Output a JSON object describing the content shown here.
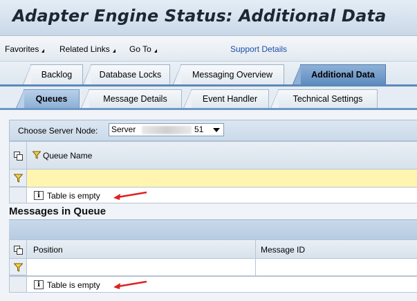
{
  "window": {
    "title": "Adapter Engine Status: Additional Data"
  },
  "menu": {
    "items": [
      {
        "label": "Favorites"
      },
      {
        "label": "Related Links"
      },
      {
        "label": "Go To"
      }
    ],
    "link": "Support Details"
  },
  "main_tabs": [
    {
      "label": "Backlog",
      "active": false
    },
    {
      "label": "Database Locks",
      "active": false
    },
    {
      "label": "Messaging Overview",
      "active": false
    },
    {
      "label": "Additional Data",
      "active": true
    }
  ],
  "sub_tabs": [
    {
      "label": "Queues",
      "active": true
    },
    {
      "label": "Message Details",
      "active": false
    },
    {
      "label": "Event Handler",
      "active": false
    },
    {
      "label": "Technical Settings",
      "active": false
    }
  ],
  "server_node": {
    "label": "Choose Server Node:",
    "value_prefix": "Server",
    "value_suffix": "51"
  },
  "queues_table": {
    "columns": [
      "Queue Name"
    ],
    "empty_message": "Table is empty"
  },
  "messages_section": {
    "title": "Messages in Queue",
    "columns": [
      "Position",
      "Message ID"
    ],
    "empty_message": "Table is empty"
  },
  "colors": {
    "active_tab": "#5e8cc0",
    "filter_row_highlight": "#fff5b0",
    "annotation_arrow": "#e02020"
  },
  "icons": [
    "column-settings-icon",
    "filter-icon",
    "info-icon",
    "dropdown-arrow-icon"
  ]
}
